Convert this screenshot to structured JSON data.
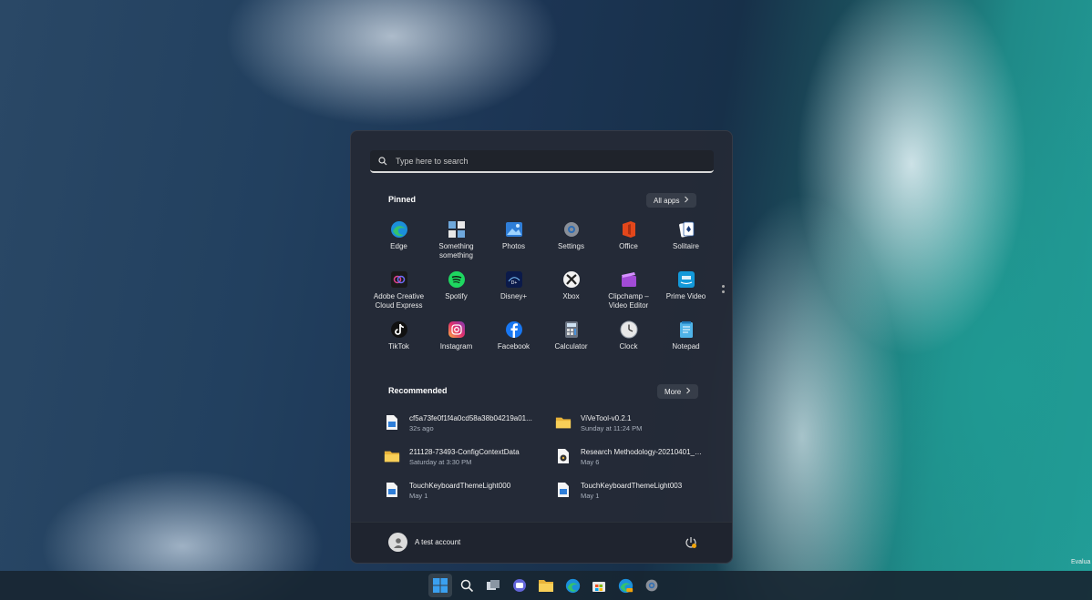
{
  "search": {
    "placeholder": "Type here to search"
  },
  "pinned": {
    "title": "Pinned",
    "all_apps_label": "All apps",
    "apps": [
      {
        "label": "Edge",
        "icon": "edge-icon"
      },
      {
        "label": "Something something",
        "icon": "app-icon"
      },
      {
        "label": "Photos",
        "icon": "photos-icon"
      },
      {
        "label": "Settings",
        "icon": "settings-icon"
      },
      {
        "label": "Office",
        "icon": "office-icon"
      },
      {
        "label": "Solitaire",
        "icon": "solitaire-icon"
      },
      {
        "label": "Adobe Creative Cloud Express",
        "icon": "adobe-icon"
      },
      {
        "label": "Spotify",
        "icon": "spotify-icon"
      },
      {
        "label": "Disney+",
        "icon": "disney-icon"
      },
      {
        "label": "Xbox",
        "icon": "xbox-icon"
      },
      {
        "label": "Clipchamp – Video Editor",
        "icon": "clipchamp-icon"
      },
      {
        "label": "Prime Video",
        "icon": "prime-video-icon"
      },
      {
        "label": "TikTok",
        "icon": "tiktok-icon"
      },
      {
        "label": "Instagram",
        "icon": "instagram-icon"
      },
      {
        "label": "Facebook",
        "icon": "facebook-icon"
      },
      {
        "label": "Calculator",
        "icon": "calculator-icon"
      },
      {
        "label": "Clock",
        "icon": "clock-icon"
      },
      {
        "label": "Notepad",
        "icon": "notepad-icon"
      }
    ]
  },
  "recommended": {
    "title": "Recommended",
    "more_label": "More",
    "items": [
      {
        "name": "cf5a73fe0f1f4a0cd58a38b04219a01...",
        "time": "32s ago",
        "icon": "image-file-icon"
      },
      {
        "name": "ViVeTool-v0.2.1",
        "time": "Sunday at 11:24 PM",
        "icon": "folder-icon"
      },
      {
        "name": "211128-73493-ConfigContextData",
        "time": "Saturday at 3:30 PM",
        "icon": "folder-icon"
      },
      {
        "name": "Research Methodology-20210401_0...",
        "time": "May 6",
        "icon": "media-file-icon"
      },
      {
        "name": "TouchKeyboardThemeLight000",
        "time": "May 1",
        "icon": "image-file-icon"
      },
      {
        "name": "TouchKeyboardThemeLight003",
        "time": "May 1",
        "icon": "image-file-icon"
      }
    ]
  },
  "user": {
    "name": "A test account"
  },
  "taskbar": {
    "items": [
      "start-icon",
      "search-icon",
      "task-view-icon",
      "chat-icon",
      "file-explorer-icon",
      "edge-icon",
      "store-icon",
      "edge-canary-icon",
      "settings-icon"
    ]
  },
  "watermark": "Evalua"
}
